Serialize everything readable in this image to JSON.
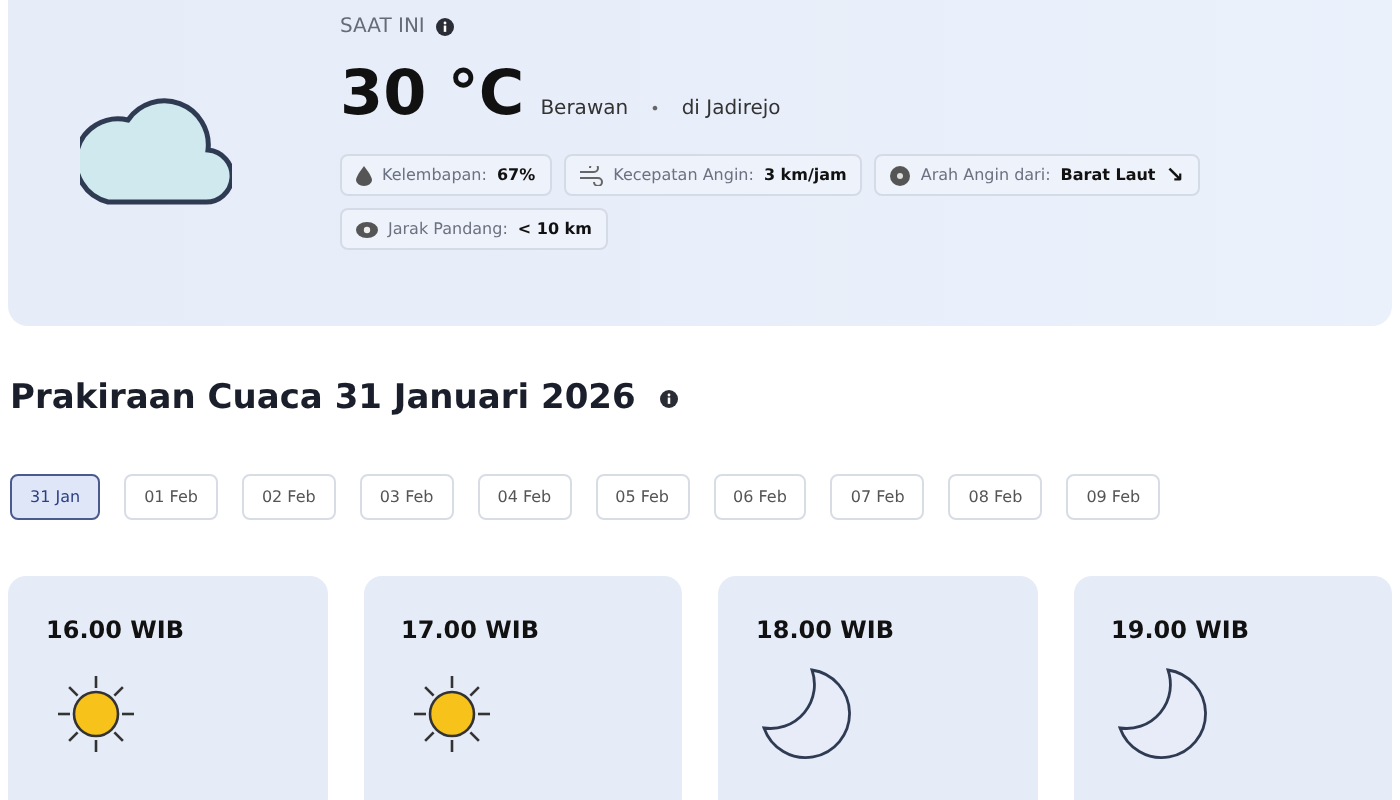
{
  "current": {
    "label": "SAAT INI",
    "temperature": "30 °C",
    "condition": "Berawan",
    "separator": "•",
    "location": "di Jadirejo",
    "details": [
      {
        "kind": "humidity",
        "label": "Kelembapan:",
        "value": "67%"
      },
      {
        "kind": "wind",
        "label": "Kecepatan Angin:",
        "value": "3 km/jam"
      },
      {
        "kind": "direction",
        "label": "Arah Angin dari:",
        "value": "Barat Laut",
        "arrow": "↘"
      },
      {
        "kind": "visibility",
        "label": "Jarak Pandang:",
        "value": "< 10 km"
      }
    ]
  },
  "forecast": {
    "title": "Prakiraan Cuaca 31 Januari 2026",
    "dates": [
      {
        "label": "31 Jan",
        "selected": true
      },
      {
        "label": "01 Feb",
        "selected": false
      },
      {
        "label": "02 Feb",
        "selected": false
      },
      {
        "label": "03 Feb",
        "selected": false
      },
      {
        "label": "04 Feb",
        "selected": false
      },
      {
        "label": "05 Feb",
        "selected": false
      },
      {
        "label": "06 Feb",
        "selected": false
      },
      {
        "label": "07 Feb",
        "selected": false
      },
      {
        "label": "08 Feb",
        "selected": false
      },
      {
        "label": "09 Feb",
        "selected": false
      }
    ],
    "hours": [
      {
        "time": "16.00 WIB",
        "kind": "sun"
      },
      {
        "time": "17.00 WIB",
        "kind": "sun"
      },
      {
        "time": "18.00 WIB",
        "kind": "moon"
      },
      {
        "time": "19.00 WIB",
        "kind": "moon"
      }
    ]
  }
}
